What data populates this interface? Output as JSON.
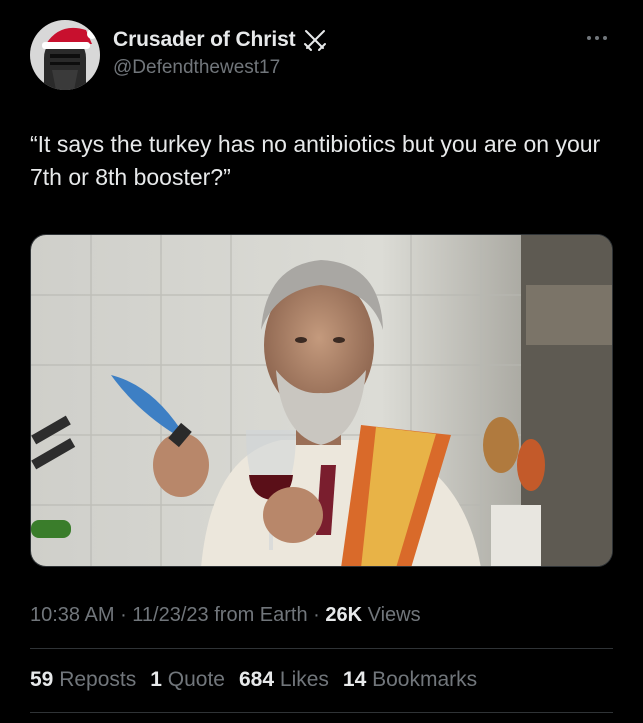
{
  "author": {
    "display_name": "Crusader of Christ",
    "handle": "@Defendthewest17",
    "avatar_icon": "knight-helmet-santa-hat-avatar",
    "badge_icon": "crossed-swords-icon"
  },
  "more_icon": "more-dots-icon",
  "tweet": {
    "text": "“It says the turkey has no antibiotics but you are on your 7th or 8th booster?”"
  },
  "media": {
    "description_icon": "photo-man-holding-knife-and-wine"
  },
  "meta": {
    "time": "10:38 AM",
    "sep1": " · ",
    "date": "11/23/23",
    "source": " from Earth",
    "sep2": " · ",
    "views_count": "26K",
    "views_label": " Views"
  },
  "stats": {
    "reposts_count": "59",
    "reposts_label": "Reposts",
    "quotes_count": "1",
    "quotes_label": "Quote",
    "likes_count": "684",
    "likes_label": "Likes",
    "bookmarks_count": "14",
    "bookmarks_label": "Bookmarks"
  },
  "colors": {
    "background": "#000000",
    "text_primary": "#e7e9ea",
    "text_secondary": "#71767b",
    "divider": "#2f3336"
  }
}
